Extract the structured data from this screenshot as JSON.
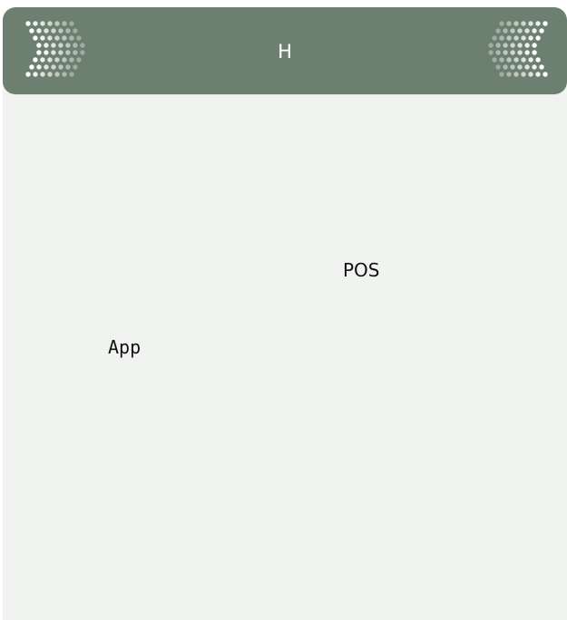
{
  "header": {
    "title": "H",
    "left_icon": "chevron-right-dots-icon",
    "right_icon": "chevron-left-dots-icon",
    "color": "#6d7f6f"
  },
  "content": {
    "pos_label": "POS",
    "app_label": "App"
  },
  "colors": {
    "background": "#f1f3f1",
    "header": "#6d7f6f",
    "dot": "#ffffff"
  }
}
